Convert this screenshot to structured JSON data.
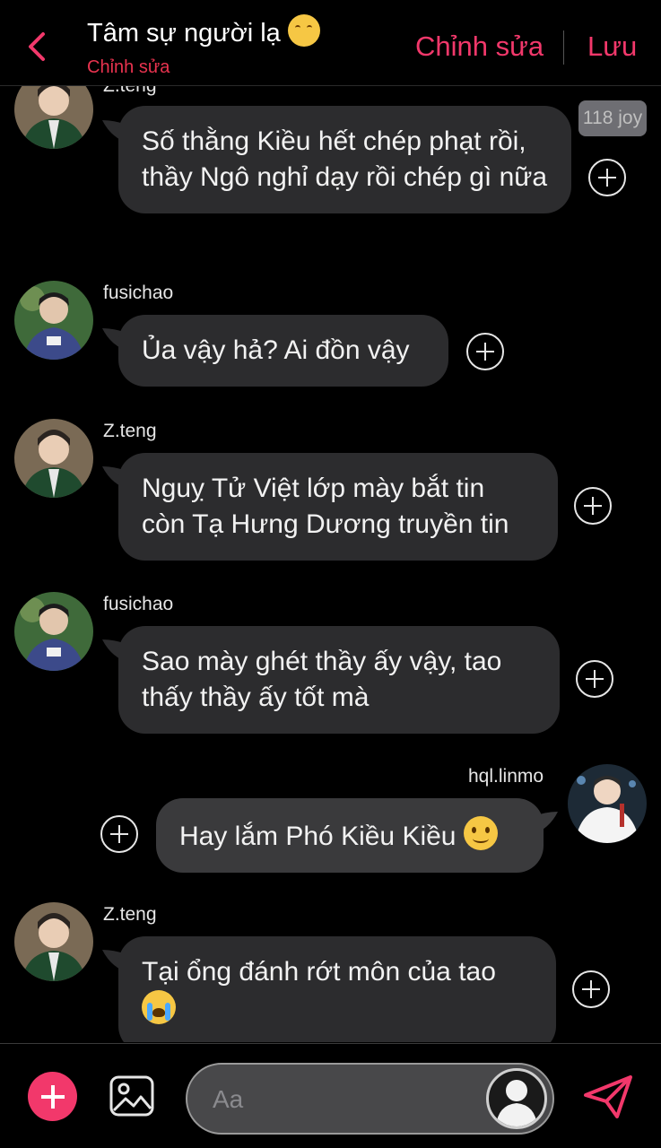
{
  "colors": {
    "accent": "#f2386b",
    "bubble": "#2c2c2e",
    "background": "#000000"
  },
  "header": {
    "title": "Tâm sự người lạ",
    "title_icon": "smiling-blush-emoji",
    "subtitle": "Chỉnh sửa",
    "edit_label": "Chỉnh sửa",
    "save_label": "Lưu",
    "back_icon": "chevron-left-icon"
  },
  "messages": [
    {
      "sender": "Z.teng",
      "text": "Số thằng Kiều hết chép phạt rồi, thầy Ngô nghỉ dạy rồi chép gì nữa",
      "badge": "118 joy"
    },
    {
      "sender": "fusichao",
      "text": "Ủa vậy hả? Ai đồn vậy"
    },
    {
      "sender": "Z.teng",
      "text": "Nguỵ Tử Việt lớp mày bắt tin còn Tạ Hưng Dương truyền tin"
    },
    {
      "sender": "fusichao",
      "text": "Sao mày ghét thầy ấy vậy, tao thấy thầy ấy tốt mà"
    },
    {
      "sender": "hql.linmo",
      "text": "Hay lắm Phó Kiều Kiều",
      "emoji": "slightly-smiling-face"
    },
    {
      "sender": "Z.teng",
      "text": "Tại ổng đánh rớt môn của tao",
      "emoji": "loudly-crying-face"
    }
  ],
  "composer": {
    "placeholder": "Aa",
    "add_icon": "plus-icon",
    "image_icon": "image-icon",
    "persona_icon": "persona-silhouette-icon",
    "send_icon": "send-icon"
  }
}
